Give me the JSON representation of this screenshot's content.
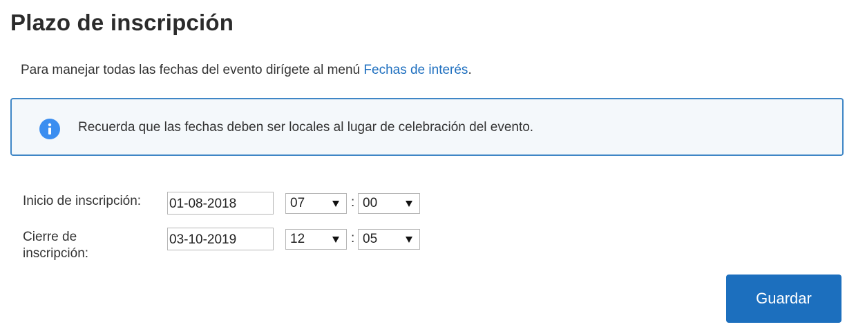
{
  "page": {
    "title": "Plazo de inscripción",
    "intro_text": "Para manejar todas las fechas del evento dirígete al menú ",
    "intro_link": "Fechas de interés",
    "intro_end": "."
  },
  "info": {
    "icon": "info-icon",
    "text": "Recuerda que las fechas deben ser locales al lugar de celebración del evento."
  },
  "form": {
    "start": {
      "label": "Inicio de inscripción:",
      "date": "01-08-2018",
      "hour": "07",
      "minute": "00"
    },
    "end": {
      "label_line1": "Cierre de",
      "label_line2": "inscripción:",
      "date": "03-10-2019",
      "hour": "12",
      "minute": "05"
    },
    "separator": ":"
  },
  "actions": {
    "save_label": "Guardar"
  },
  "colors": {
    "accent": "#1c6fbe",
    "link": "#1e6fbf",
    "info_border": "#3f86c6",
    "info_icon": "#3b8ef0"
  }
}
